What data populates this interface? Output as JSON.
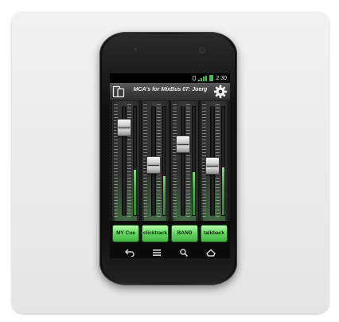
{
  "status_bar": {
    "time": "2:30"
  },
  "title_bar": {
    "title": "MCA's for MixBus 07: Joerg"
  },
  "channels": [
    {
      "label": "MY Cue",
      "fader_level": 0.86,
      "meter_level": 0.42
    },
    {
      "label": "clicktrack",
      "fader_level": 0.46,
      "meter_level": 0.36
    },
    {
      "label": "BAND",
      "fader_level": 0.68,
      "meter_level": 0.4
    },
    {
      "label": "talkback",
      "fader_level": 0.45,
      "meter_level": 0.44
    }
  ],
  "nav": {
    "icons": [
      "back-icon",
      "menu-icon",
      "search-icon",
      "home-icon"
    ]
  },
  "colors": {
    "accent": "#5fd35a",
    "button_text": "#0d2a0d",
    "title_bg": "#3e3e3e"
  }
}
